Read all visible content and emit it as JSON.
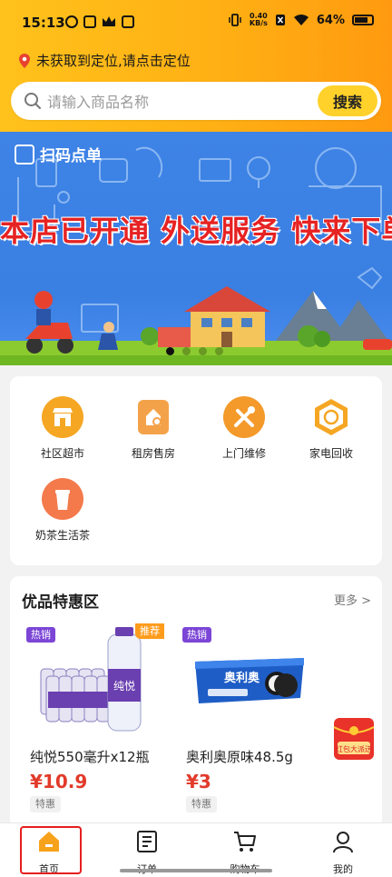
{
  "status_bar": {
    "time": "15:13",
    "speed_value": "0.40",
    "speed_unit": "KB/s",
    "battery": "64%"
  },
  "location": {
    "text": "未获取到定位,请点击定位",
    "pin_color": "#e8422f"
  },
  "search": {
    "placeholder": "请输入商品名称",
    "button_label": "搜索"
  },
  "banner": {
    "logo_text": "扫码点单",
    "headline": "本店已开通 外送服务 快来下单吧",
    "slides_count": 4,
    "active_slide": 1
  },
  "categories": [
    {
      "label": "社区超市",
      "icon": "store-icon",
      "color": "#f5a623"
    },
    {
      "label": "租房售房",
      "icon": "house-search-icon",
      "color": "#f4a24a"
    },
    {
      "label": "上门维修",
      "icon": "repair-tools-icon",
      "color": "#f39a2a"
    },
    {
      "label": "家电回收",
      "icon": "recycle-icon",
      "color": "#f5a623"
    },
    {
      "label": "奶茶生活茶",
      "icon": "milk-tea-icon",
      "color": "#f47a4c"
    }
  ],
  "promo": {
    "title": "优品特惠区",
    "more_label": "更多 >",
    "products": [
      {
        "tag": "热销",
        "corner_tag": "推荐",
        "name": "纯悦550毫升x12瓶",
        "price": "¥10.9",
        "badge": "特惠",
        "image": "water-bottles-image"
      },
      {
        "tag": "热销",
        "name": "奥利奥原味48.5g",
        "price": "¥3",
        "badge": "特惠",
        "image": "oreo-pack-image"
      }
    ]
  },
  "floating_redpack": {
    "text": "红包大派送"
  },
  "bottom_nav": [
    {
      "label": "首页",
      "icon": "home-icon",
      "active": true
    },
    {
      "label": "订单",
      "icon": "order-list-icon",
      "active": false
    },
    {
      "label": "购物车",
      "icon": "cart-icon",
      "active": false
    },
    {
      "label": "我的",
      "icon": "user-icon",
      "active": false
    }
  ],
  "colors": {
    "header_gradient_start": "#ffc21c",
    "header_gradient_end": "#ff9a10",
    "search_button": "#ffd12a",
    "price": "#e23a2a",
    "hot_tag": "#7b45d6",
    "recommend_tag": "#ff9c1c",
    "nav_highlight": "#e61e1e"
  }
}
